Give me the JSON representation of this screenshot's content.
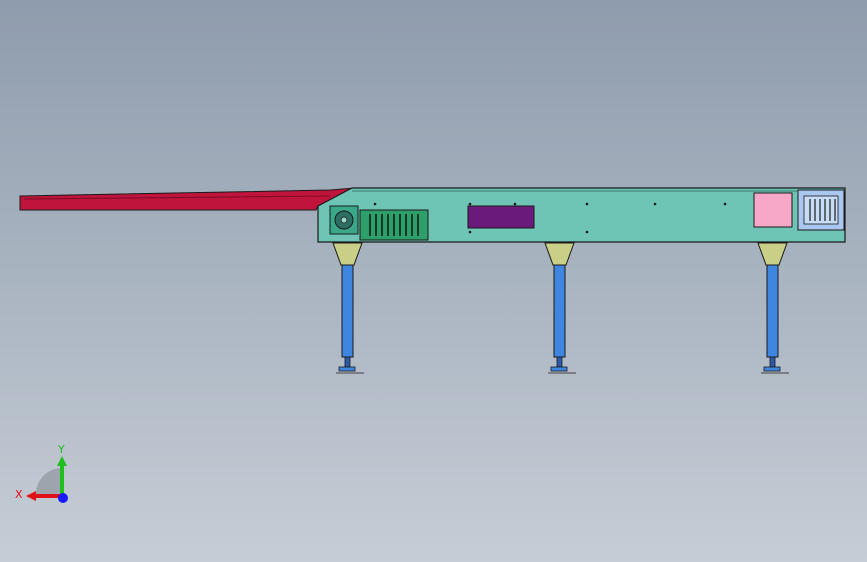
{
  "viewport": {
    "background_top": "#8f9cad",
    "background_bottom": "#c6cdd6",
    "colors": {
      "chute": "#c0143c",
      "body": "#6ec4b5",
      "legs": "#3f86e0",
      "cones": "#c9cf86",
      "motor_box": "#2e9f6a",
      "panel": "#6a1a7a",
      "window": "#f7a8c8",
      "vent": "#a9c7f0",
      "outline": "#1a1a1a"
    }
  },
  "triad": {
    "x_label": "X",
    "y_label": "Y",
    "x_color": "#e0101a",
    "y_color": "#1fbf1f",
    "z_color": "#1a1aff"
  }
}
